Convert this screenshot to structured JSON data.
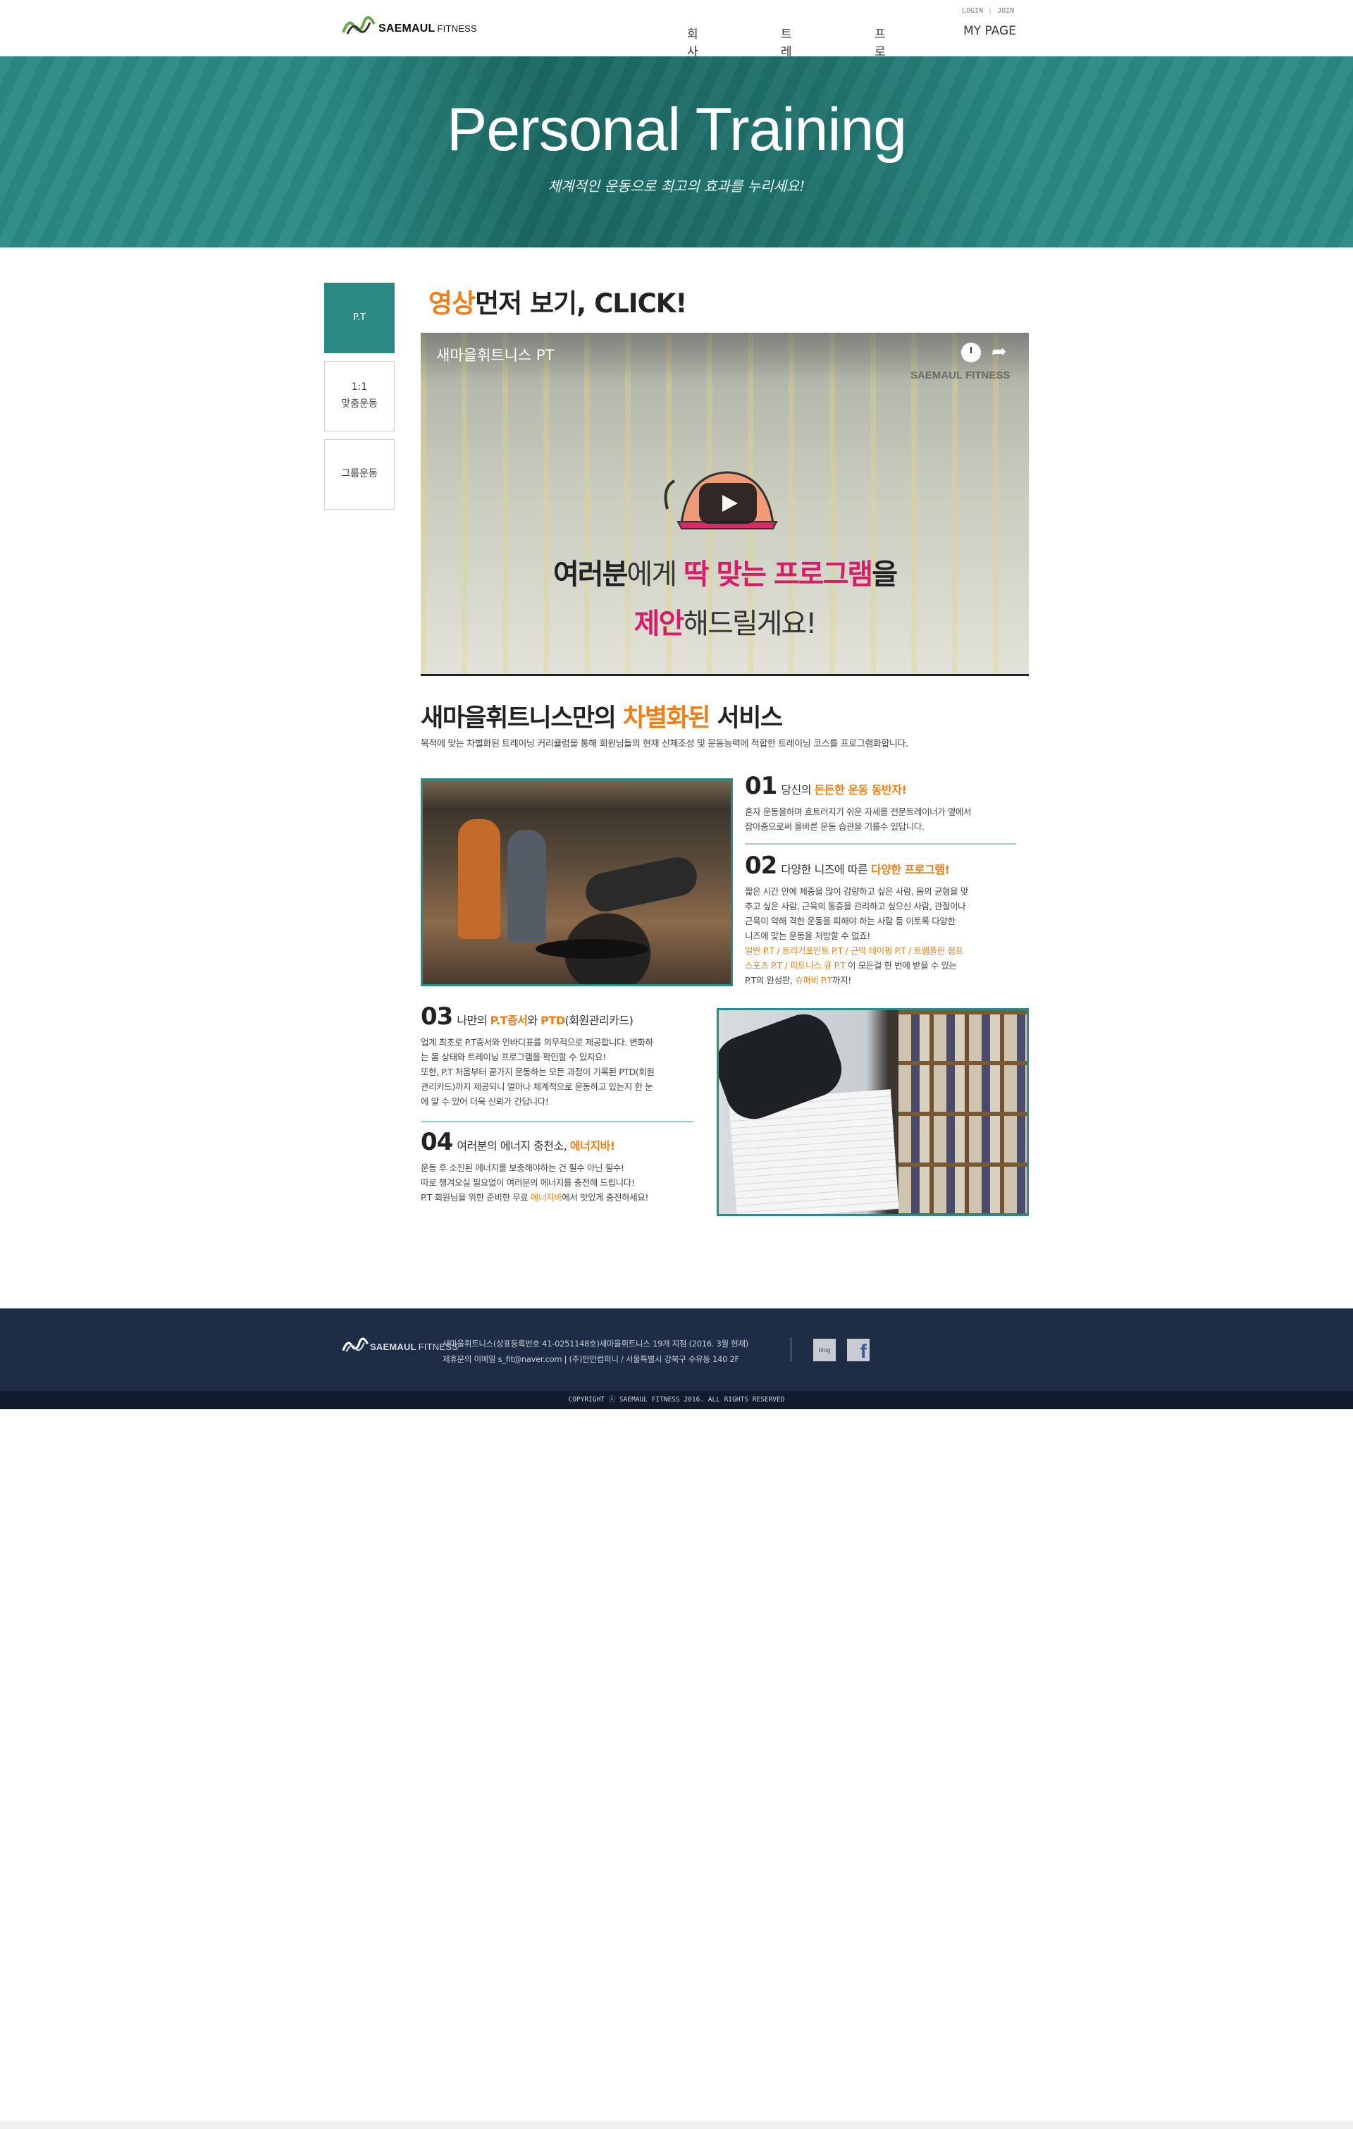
{
  "header": {
    "logo": {
      "brand": "SAEMAUL",
      "suffix": "FITNESS"
    },
    "util": {
      "login": "LOGIN",
      "join": "JOIN"
    },
    "nav": [
      {
        "label": "회사소개"
      },
      {
        "label": "트레이너"
      },
      {
        "label": "프로그램"
      },
      {
        "label": "MY PAGE"
      }
    ]
  },
  "hero": {
    "title": "Personal Training",
    "subtitle": "체계적인 운동으로 최고의 효과를 누리세요!"
  },
  "side_menu": [
    {
      "label": "P.T",
      "active": true
    },
    {
      "label_line1": "1:1",
      "label_line2": "맞춤운동",
      "active": false
    },
    {
      "label": "그룹운동",
      "active": false
    }
  ],
  "video_section": {
    "title_highlight": "영상",
    "title_rest": "먼저 보기, CLICK!",
    "video": {
      "name": "새마을휘트니스 PT",
      "brand": "SAEMAUL FITNESS",
      "line1_a": "여러분",
      "line1_b": "에게 ",
      "line1_c": "딱 맞는 프로그램",
      "line1_d": "을",
      "line2_a": "제안",
      "line2_b": "해드릴게요!",
      "clock_icon": "clock-icon",
      "share_icon": "share-icon",
      "play_icon": "play-icon"
    }
  },
  "service": {
    "title_a": "새마을휘트니스만의 ",
    "title_hl": "차별화된",
    "title_b": " 서비스",
    "desc": "목적에 맞는 차별화된 트레이닝 커리큘럼을 통해 회원님들의 현재 신체조성 및 운동능력에 적합한 트레이닝 코스를 프로그램화합니다.",
    "items": [
      {
        "num": "01",
        "head_a": "당신의 ",
        "head_hl": "든든한 운동 동반자!",
        "body": [
          "혼자 운동을하며 흐트러지기 쉬운 자세를 전문트레이너가 옆에서",
          "잡아줌으로써 올바른 운동 습관을 기를수 있답니다."
        ]
      },
      {
        "num": "02",
        "head_a": "다양한 니즈에 따른 ",
        "head_hl": "다양한 프로그램!",
        "body": [
          "짧은 시간 안에 체중을 많이 감량하고 싶은 사람, 몸의 균형을 맞",
          "추고 싶은 사람, 근육의 통증을 관리하고 싶으신 사람, 관절이나",
          "근육이 약해 격한 운동을 피해야 하는 사람 등 이토록 다양한",
          "니즈에 맞는 운동을 처방할 수 없죠!"
        ],
        "programs_1": "일반 P.T / 트리거포인트 P.T / 근막 테이핑 P.T / 트램폴린 점프",
        "programs_2": "스포츠 P.T / 피트니스 큐 P.T",
        "programs_2_tail": "  이 모든걸 한 번에 받을 수 있는",
        "last_a": "P.T의 완성판, ",
        "last_hl": "슈퍼비 P.T",
        "last_b": "까지!"
      },
      {
        "num": "03",
        "head_a": "나만의  ",
        "head_hl1": "P.T증서",
        "head_mid": "와 ",
        "head_hl2": "PTD",
        "head_b": "(회원관리카드)",
        "body": [
          "업계 최초로 P.T증서와 인바디표를 의무적으로 제공합니다. 변화하",
          "는 몸 상태와 트레이닝 프로그램을 확인할 수 있지요!",
          "또한, P.T 처음부터 끝가지 운동하는 모든 과정이 기록된 PTD(회원",
          "관리카드)까지 제공되니 얼마나 체계적으로 운동하고 있는지 한 눈",
          "에 알 수 있어 더욱 신뢰가 간답니다!"
        ]
      },
      {
        "num": "04",
        "head_a": "여러분의 에너지 충천소, ",
        "head_hl": "에너지바!",
        "body": [
          "운동 후 소진된 에너지를 보충해야하는 건 필수 아닌 필수!",
          "따로 챙겨오실 필요없이 여러분의 에너지를 충전해 드립니다!"
        ],
        "last_a": "P.T 회원님을 위한 준비한 무료 ",
        "last_hl": "에너지바",
        "last_b": "에서 맛있게 충전하세요!"
      }
    ]
  },
  "footer": {
    "logo": {
      "brand": "SAEMAUL",
      "suffix": "FITNESS"
    },
    "info_line1": "새마을휘트니스(상표등록번호 41-0251148호)새마을휘트니스 19개 지점 (2016. 3월 현재)",
    "info_line2": "제휴문의 이메일 s_fit@naver.com  |  (주)만만컴퍼니 / 서울특별시 강북구 수유동 140 2F",
    "blog_label": "blog",
    "fb_label": "f",
    "copyright": "COPYRIGHT ⓒ SAEMAUL FITNESS 2016. ALL RIGHTS RESERVED"
  },
  "colors": {
    "accent": "#2b8a84",
    "highlight": "#f07e17",
    "footer_bg": "#1e2d45"
  }
}
